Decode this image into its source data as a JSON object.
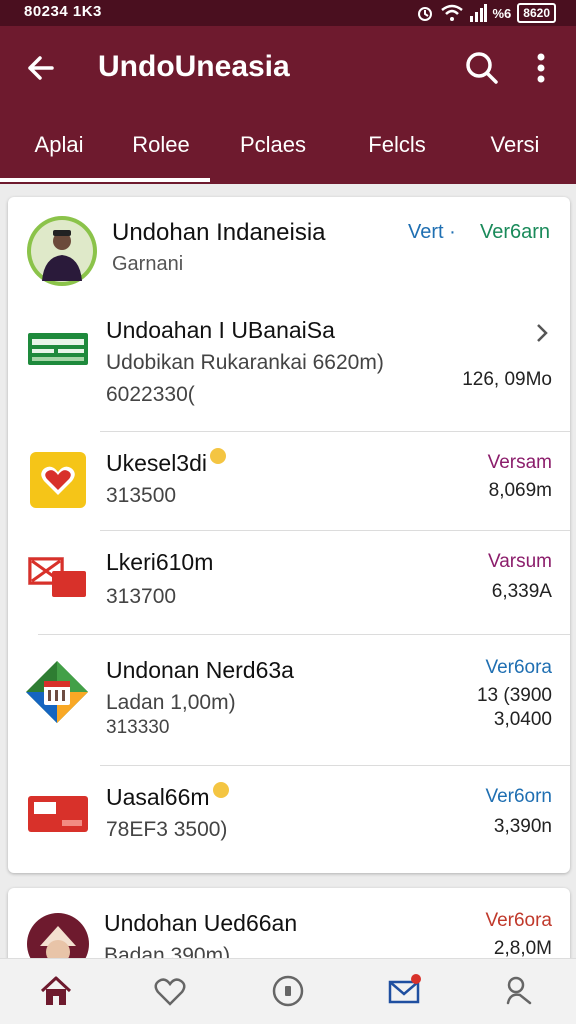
{
  "status_bar": {
    "time": "80234 1K3",
    "signal": "%6",
    "battery": "8620"
  },
  "app_bar": {
    "title": "UndoUneasia"
  },
  "tabs": [
    "Aplai",
    "Rolee",
    "Pclaes",
    "Felcls",
    "Versi"
  ],
  "header_row": {
    "title": "Undohan Indaneisia",
    "subtitle": "Garnani",
    "link_1": "Vert ·",
    "link_2": "Ver6arn"
  },
  "items": [
    {
      "title": "Undoahan I UBanaiSa",
      "line1": "Udobikan Rukarankai 6620m)",
      "line2": "6022330(",
      "right1": "126, 09Mo",
      "right2": "",
      "color": "#1a1a1a"
    },
    {
      "title": "Ukesel3di",
      "line1": "313500",
      "line2": "",
      "right1": "Versam",
      "right2": "8,069m",
      "color": "#8b1d6b"
    },
    {
      "title": "Lkeri610m",
      "line1": "313700",
      "line2": "",
      "right1": "Varsum",
      "right2": "6,339A",
      "color": "#8b1d6b"
    },
    {
      "title": "Undonan Nerd63a",
      "line1": "Ladan 1,00m)",
      "line2": "313330",
      "right1": "Ver6ora",
      "right2": "13 (3900",
      "right3": "3,0400",
      "color": "#1f6fb2"
    },
    {
      "title": "Uasal66m",
      "line1": "78EF3 3500)",
      "line2": "",
      "right1": "Ver6orn",
      "right2": "3,390n",
      "color": "#1f6fb2"
    }
  ],
  "next_card": {
    "title": "Undohan Ued66an",
    "line1": "Badan 390m)",
    "right1": "Ver6ora",
    "right2": "2,8,0M"
  },
  "colors": {
    "header": "#6e1a2e",
    "status": "#4a0f1f",
    "link_blue": "#1f6fb2",
    "link_green": "#1a8a5a",
    "version_purple": "#8b1d6b",
    "version_red": "#c0392b"
  }
}
